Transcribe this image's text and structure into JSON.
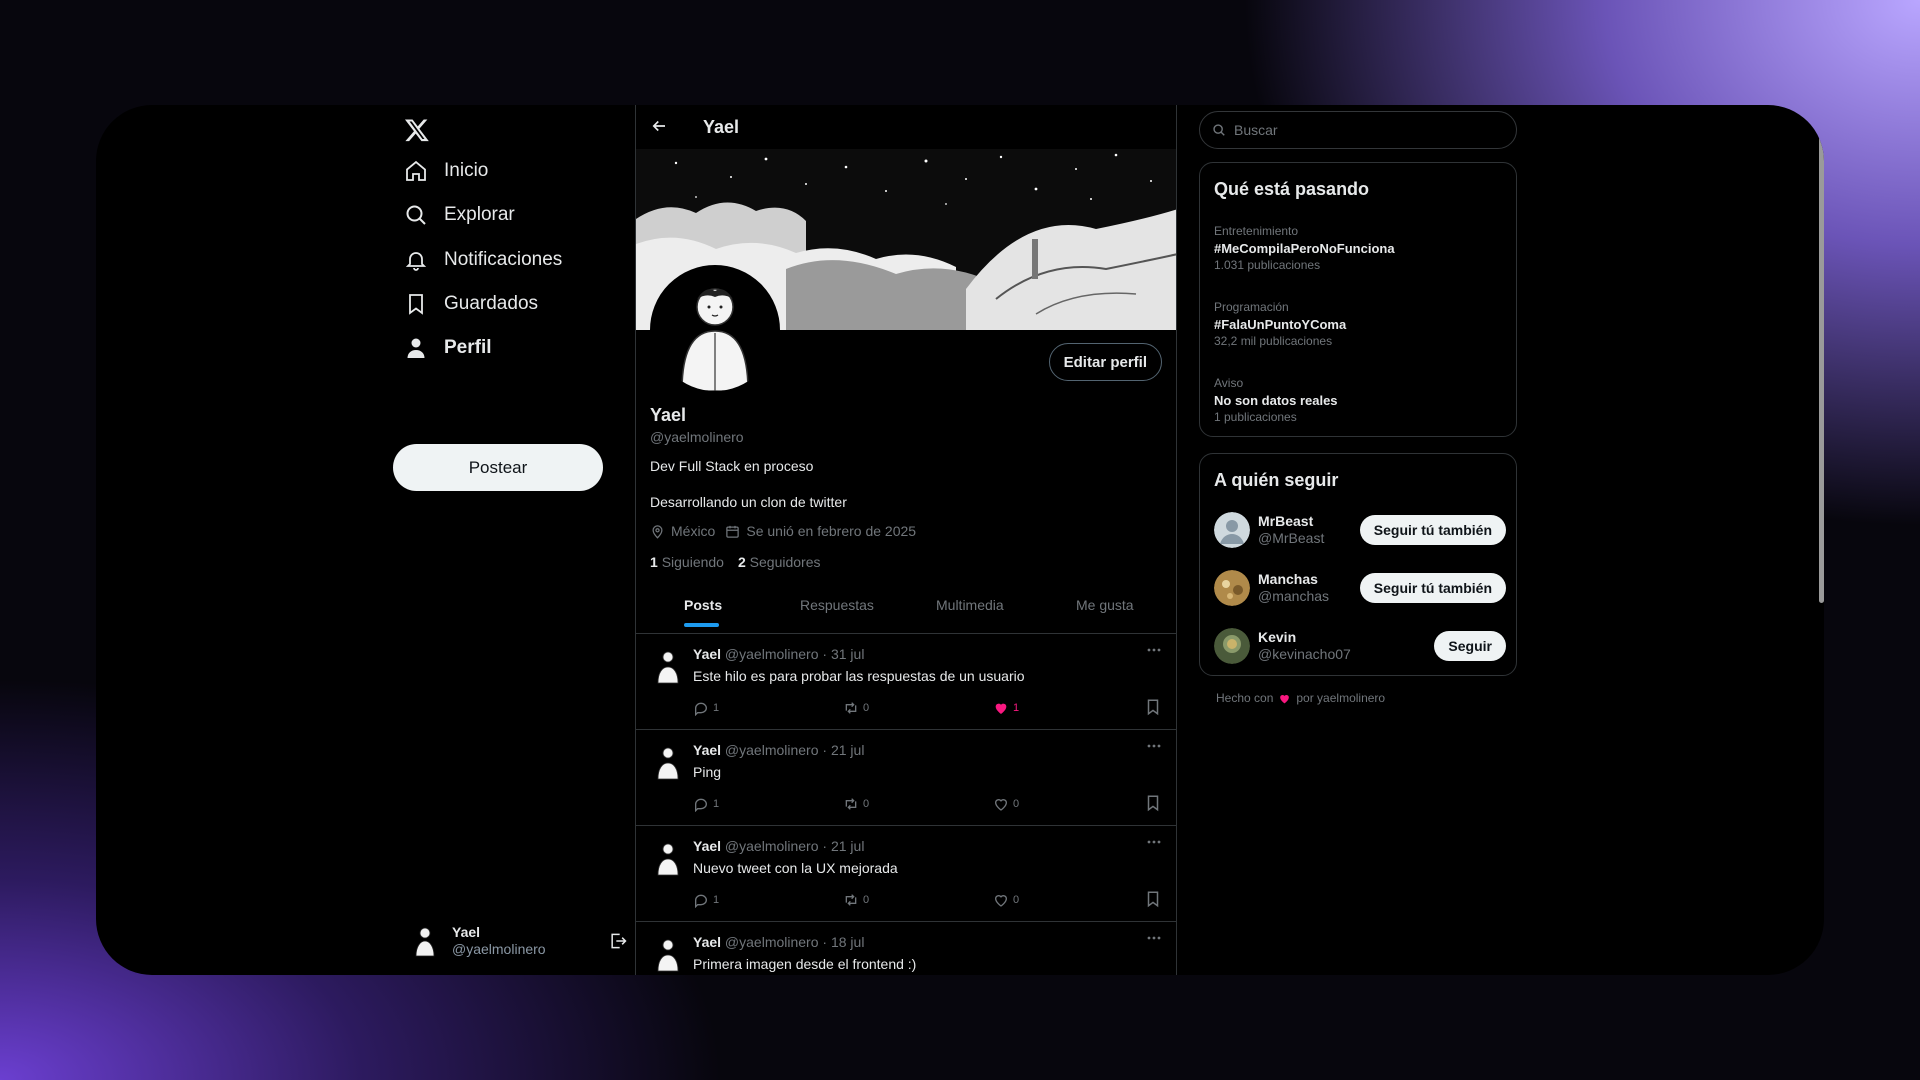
{
  "sidebar": {
    "logo": "x-logo-icon",
    "items": [
      {
        "label": "Inicio",
        "icon": "home-icon"
      },
      {
        "label": "Explorar",
        "icon": "search-icon"
      },
      {
        "label": "Notificaciones",
        "icon": "bell-icon"
      },
      {
        "label": "Guardados",
        "icon": "bookmark-icon"
      },
      {
        "label": "Perfil",
        "icon": "person-icon"
      }
    ],
    "post_button": "Postear",
    "account": {
      "name": "Yael",
      "handle": "@yaelmolinero"
    }
  },
  "profile": {
    "header_title": "Yael",
    "edit_button": "Editar perfil",
    "name": "Yael",
    "handle": "@yaelmolinero",
    "bio_line1": "Dev Full Stack en proceso",
    "bio_line2": "Desarrollando un clon de twitter",
    "location": "México",
    "joined": "Se unió en febrero de 2025",
    "following_count": "1",
    "following_label": "Siguiendo",
    "followers_count": "2",
    "followers_label": "Seguidores"
  },
  "tabs": [
    {
      "label": "Posts",
      "active": true
    },
    {
      "label": "Respuestas",
      "active": false
    },
    {
      "label": "Multimedia",
      "active": false
    },
    {
      "label": "Me gusta",
      "active": false
    }
  ],
  "tweets": [
    {
      "name": "Yael",
      "handle": "@yaelmolinero",
      "date": "31 jul",
      "text": "Este hilo es para probar las respuestas de un usuario",
      "replies": "1",
      "retweets": "0",
      "likes": "1",
      "liked": true
    },
    {
      "name": "Yael",
      "handle": "@yaelmolinero",
      "date": "21 jul",
      "text": "Ping",
      "replies": "1",
      "retweets": "0",
      "likes": "0",
      "liked": false
    },
    {
      "name": "Yael",
      "handle": "@yaelmolinero",
      "date": "21 jul",
      "text": "Nuevo tweet con la UX mejorada",
      "replies": "1",
      "retweets": "0",
      "likes": "0",
      "liked": false
    },
    {
      "name": "Yael",
      "handle": "@yaelmolinero",
      "date": "18 jul",
      "text": "Primera imagen desde el frontend :)"
    }
  ],
  "search": {
    "placeholder": "Buscar"
  },
  "trending": {
    "title": "Qué está pasando",
    "items": [
      {
        "category": "Entretenimiento",
        "tag": "#MeCompilaPeroNoFunciona",
        "count": "1.031 publicaciones"
      },
      {
        "category": "Programación",
        "tag": "#FalaUnPuntoYComa",
        "count": "32,2 mil publicaciones"
      },
      {
        "category": "Aviso",
        "tag": "No son datos reales",
        "count": "1 publicaciones"
      }
    ]
  },
  "who_to_follow": {
    "title": "A quién seguir",
    "users": [
      {
        "name": "MrBeast",
        "handle": "@MrBeast",
        "button": "Seguir tú también"
      },
      {
        "name": "Manchas",
        "handle": "@manchas",
        "button": "Seguir tú también"
      },
      {
        "name": "Kevin",
        "handle": "@kevinacho07",
        "button": "Seguir"
      }
    ]
  },
  "footer": {
    "made_with": "Hecho con",
    "by": "por yaelmolinero"
  },
  "colors": {
    "accent": "#1d9bf0",
    "like": "#f91880",
    "background": "#000000"
  }
}
